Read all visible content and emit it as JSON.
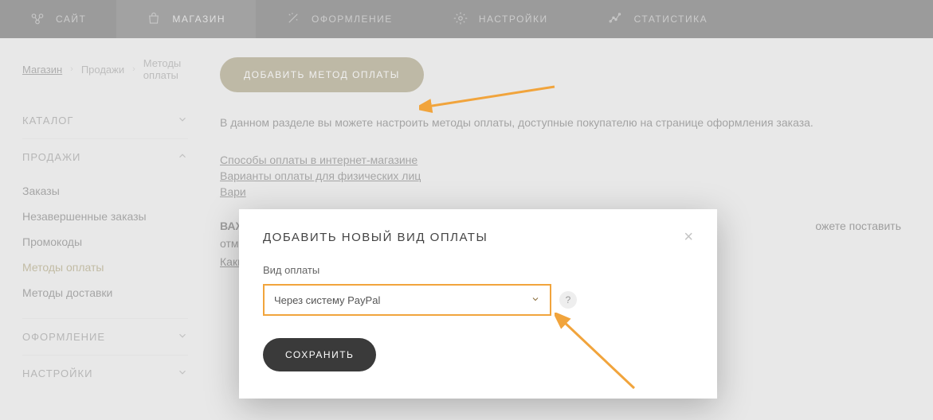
{
  "topbar": {
    "items": [
      {
        "label": "САЙТ"
      },
      {
        "label": "МАГАЗИН"
      },
      {
        "label": "ОФОРМЛЕНИЕ"
      },
      {
        "label": "НАСТРОЙКИ"
      },
      {
        "label": "СТАТИСТИКА"
      }
    ]
  },
  "breadcrumb": {
    "items": [
      "Магазин",
      "Продажи",
      "Методы оплаты"
    ]
  },
  "sidebar": {
    "sections": [
      {
        "title": "КАТАЛОГ"
      },
      {
        "title": "ПРОДАЖИ",
        "items": [
          "Заказы",
          "Незавершенные заказы",
          "Промокоды",
          "Методы оплаты",
          "Методы доставки"
        ]
      },
      {
        "title": "ОФОРМЛЕНИЕ"
      },
      {
        "title": "НАСТРОЙКИ"
      }
    ]
  },
  "main": {
    "add_button": "ДОБАВИТЬ МЕТОД ОПЛАТЫ",
    "intro": "В данном разделе вы можете настроить методы оплаты, доступные покупателю на странице оформления заказа.",
    "links": [
      "Способы оплаты в интернет-магазине",
      "Варианты оплаты для физических лиц",
      "Вари"
    ],
    "warn_prefix": "ВАЖ",
    "warn_line2": "отме",
    "warn_suffix": "ожете поставить",
    "warn_link": "Каки"
  },
  "modal": {
    "title": "ДОБАВИТЬ НОВЫЙ ВИД ОПЛАТЫ",
    "field_label": "Вид оплаты",
    "select_value": "Через систему PayPal",
    "help": "?",
    "save": "СОХРАНИТЬ"
  }
}
